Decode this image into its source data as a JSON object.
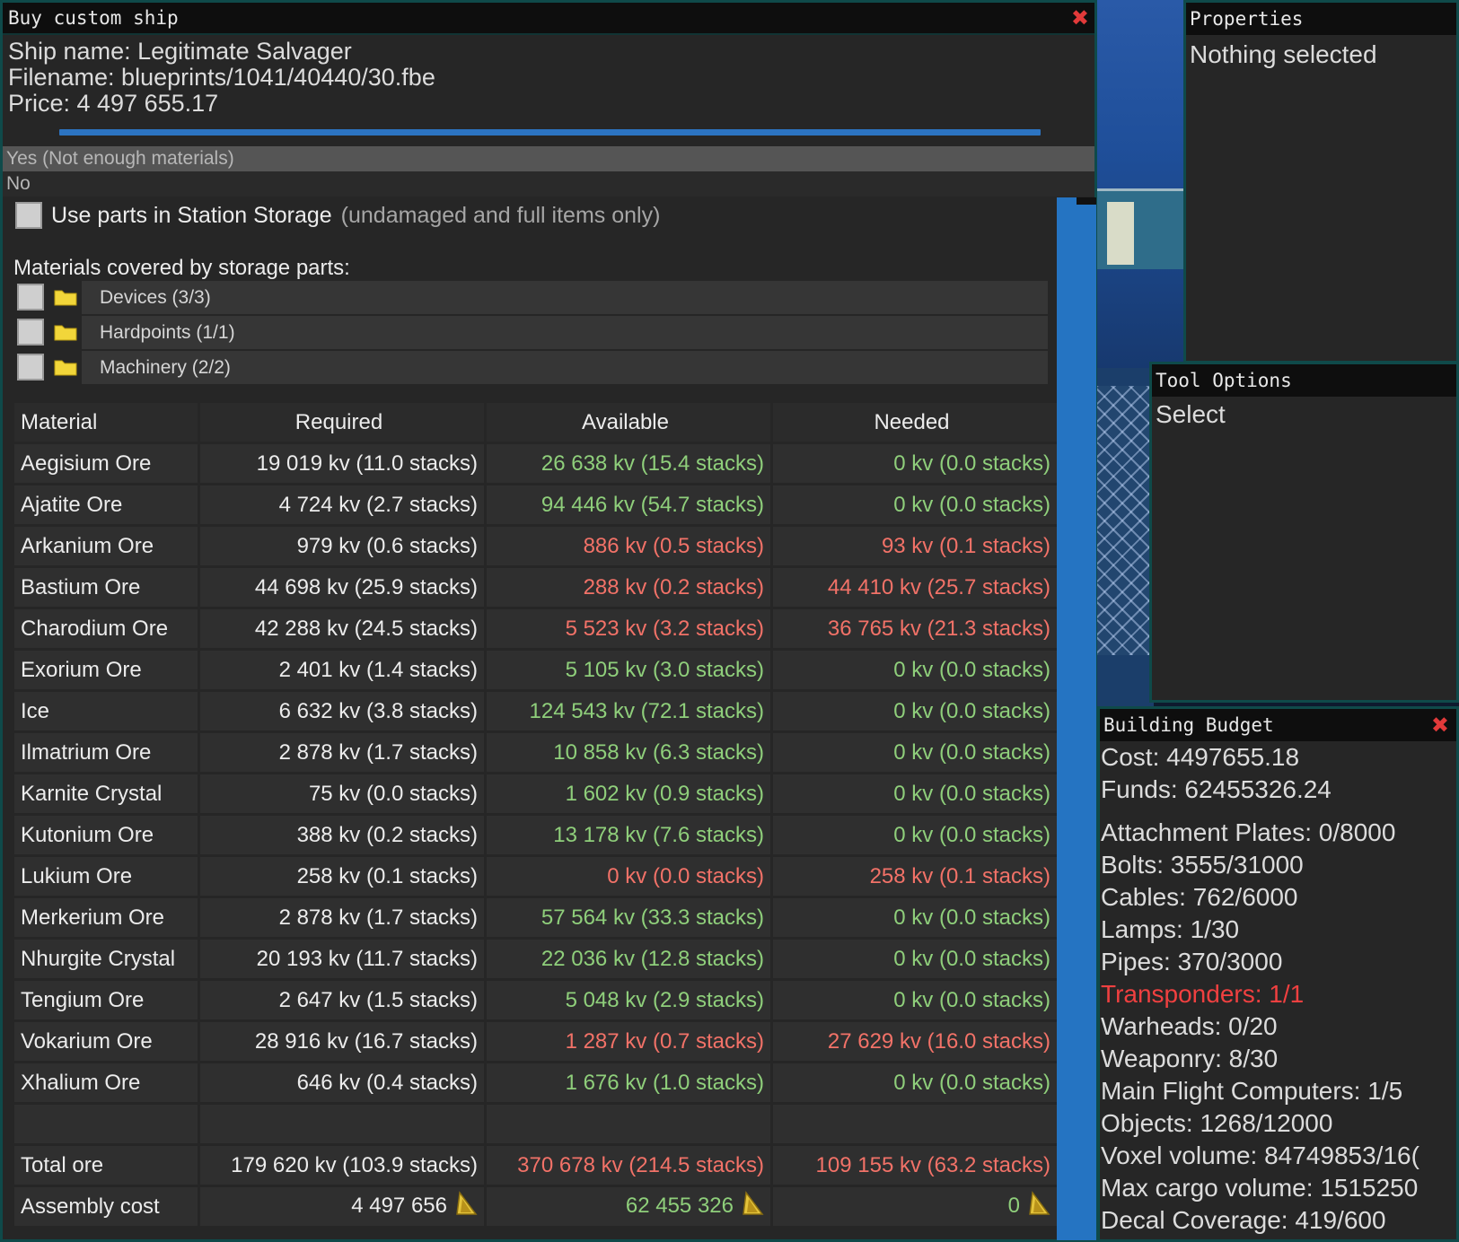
{
  "buy_dialog": {
    "title": "Buy custom ship",
    "ship_name": "Ship name: Legitimate Salvager",
    "filename": "Filename: blueprints/1041/40440/30.fbe",
    "price": "Price: 4 497 655.17",
    "option_yes": "Yes  (Not enough materials)",
    "option_no": "No",
    "use_storage_label": "Use parts in Station Storage",
    "use_storage_note": "(undamaged and full items only)",
    "covered_label": "Materials covered by storage parts:",
    "categories": [
      "Devices (3/3)",
      "Hardpoints (1/1)",
      "Machinery (2/2)"
    ]
  },
  "table": {
    "headers": [
      "Material",
      "Required",
      "Available",
      "Needed"
    ],
    "rows": [
      {
        "material": "Aegisium Ore",
        "required": "19 019 kv (11.0 stacks)",
        "available": "26 638 kv (15.4 stacks)",
        "needed": "0 kv (0.0 stacks)",
        "status": "ok"
      },
      {
        "material": "Ajatite Ore",
        "required": "4 724 kv (2.7 stacks)",
        "available": "94 446 kv (54.7 stacks)",
        "needed": "0 kv (0.0 stacks)",
        "status": "ok"
      },
      {
        "material": "Arkanium Ore",
        "required": "979 kv (0.6 stacks)",
        "available": "886 kv (0.5 stacks)",
        "needed": "93 kv (0.1 stacks)",
        "status": "bad"
      },
      {
        "material": "Bastium Ore",
        "required": "44 698 kv (25.9 stacks)",
        "available": "288 kv (0.2 stacks)",
        "needed": "44 410 kv (25.7 stacks)",
        "status": "bad"
      },
      {
        "material": "Charodium Ore",
        "required": "42 288 kv (24.5 stacks)",
        "available": "5 523 kv (3.2 stacks)",
        "needed": "36 765 kv (21.3 stacks)",
        "status": "bad"
      },
      {
        "material": "Exorium Ore",
        "required": "2 401 kv (1.4 stacks)",
        "available": "5 105 kv (3.0 stacks)",
        "needed": "0 kv (0.0 stacks)",
        "status": "ok"
      },
      {
        "material": "Ice",
        "required": "6 632 kv (3.8 stacks)",
        "available": "124 543 kv (72.1 stacks)",
        "needed": "0 kv (0.0 stacks)",
        "status": "ok"
      },
      {
        "material": "Ilmatrium Ore",
        "required": "2 878 kv (1.7 stacks)",
        "available": "10 858 kv (6.3 stacks)",
        "needed": "0 kv (0.0 stacks)",
        "status": "ok"
      },
      {
        "material": "Karnite Crystal",
        "required": "75 kv (0.0 stacks)",
        "available": "1 602 kv (0.9 stacks)",
        "needed": "0 kv (0.0 stacks)",
        "status": "ok"
      },
      {
        "material": "Kutonium Ore",
        "required": "388 kv (0.2 stacks)",
        "available": "13 178 kv (7.6 stacks)",
        "needed": "0 kv (0.0 stacks)",
        "status": "ok"
      },
      {
        "material": "Lukium Ore",
        "required": "258 kv (0.1 stacks)",
        "available": "0 kv (0.0 stacks)",
        "needed": "258 kv (0.1 stacks)",
        "status": "bad"
      },
      {
        "material": "Merkerium Ore",
        "required": "2 878 kv (1.7 stacks)",
        "available": "57 564 kv (33.3 stacks)",
        "needed": "0 kv (0.0 stacks)",
        "status": "ok"
      },
      {
        "material": "Nhurgite Crystal",
        "required": "20 193 kv (11.7 stacks)",
        "available": "22 036 kv (12.8 stacks)",
        "needed": "0 kv (0.0 stacks)",
        "status": "ok"
      },
      {
        "material": "Tengium Ore",
        "required": "2 647 kv (1.5 stacks)",
        "available": "5 048 kv (2.9 stacks)",
        "needed": "0 kv (0.0 stacks)",
        "status": "ok"
      },
      {
        "material": "Vokarium Ore",
        "required": "28 916 kv (16.7 stacks)",
        "available": "1 287 kv (0.7 stacks)",
        "needed": "27 629 kv (16.0 stacks)",
        "status": "bad"
      },
      {
        "material": "Xhalium Ore",
        "required": "646 kv (0.4 stacks)",
        "available": "1 676 kv (1.0 stacks)",
        "needed": "0 kv (0.0 stacks)",
        "status": "ok"
      }
    ],
    "total": {
      "material": "Total ore",
      "required": "179 620 kv (103.9 stacks)",
      "available": "370 678 kv (214.5 stacks)",
      "needed": "109 155 kv (63.2 stacks)",
      "status": "bad"
    },
    "assembly": {
      "material": "Assembly cost",
      "required": "4 497 656",
      "available": "62 455 326",
      "needed": "0"
    }
  },
  "properties": {
    "title": "Properties",
    "body": "Nothing selected"
  },
  "tool_options": {
    "title": "Tool Options",
    "body": "Select"
  },
  "budget": {
    "title": "Building Budget",
    "cost": "Cost: 4497655.18",
    "funds": "Funds: 62455326.24",
    "lines": [
      {
        "text": "Attachment Plates: 0/8000",
        "warn": false
      },
      {
        "text": "Bolts: 3555/31000",
        "warn": false
      },
      {
        "text": "Cables: 762/6000",
        "warn": false
      },
      {
        "text": "Lamps: 1/30",
        "warn": false
      },
      {
        "text": "Pipes: 370/3000",
        "warn": false
      },
      {
        "text": "Transponders: 1/1",
        "warn": true
      },
      {
        "text": "Warheads: 0/20",
        "warn": false
      },
      {
        "text": "Weaponry: 8/30",
        "warn": false
      },
      {
        "text": "Main Flight Computers: 1/5",
        "warn": false
      },
      {
        "text": "Objects: 1268/12000",
        "warn": false
      },
      {
        "text": "Voxel volume: 84749853/16(",
        "warn": false
      },
      {
        "text": "Max cargo volume: 1515250",
        "warn": false
      },
      {
        "text": "Decal Coverage: 419/600",
        "warn": false
      }
    ]
  },
  "colors": {
    "ok": "#8fcf7b",
    "bad": "#f27268",
    "warn": "#f04040",
    "accent": "#2574c2"
  },
  "icons": {
    "close": "close-icon",
    "folder": "folder-icon",
    "coin": "credits-icon"
  }
}
